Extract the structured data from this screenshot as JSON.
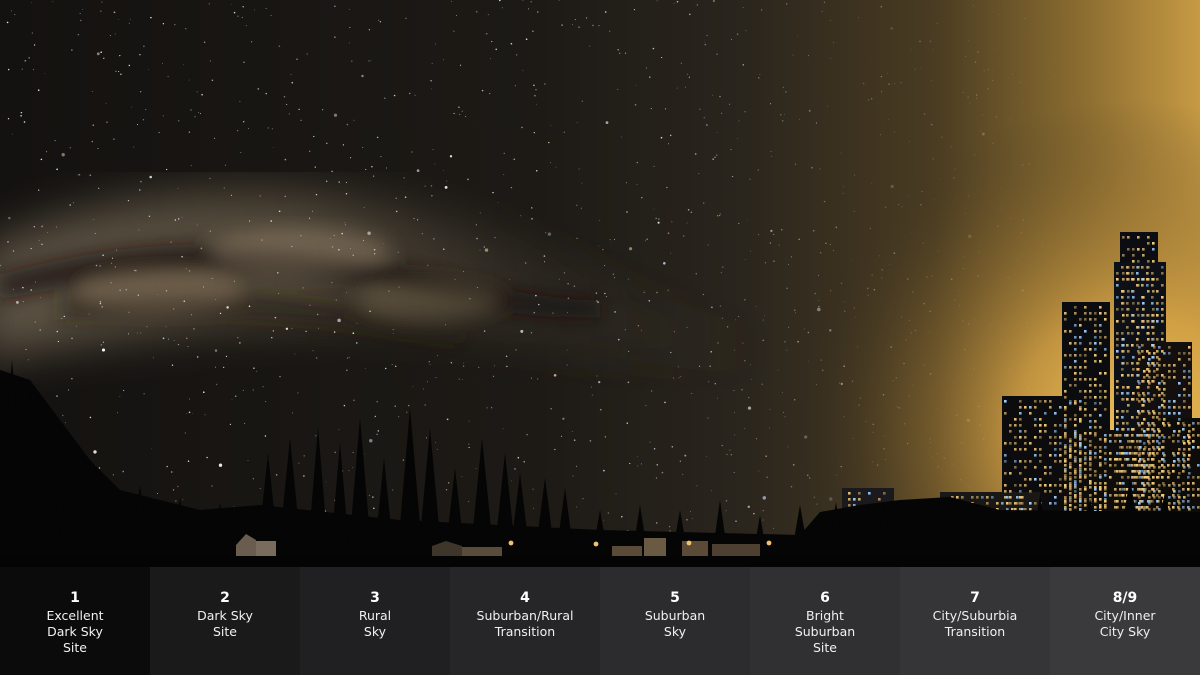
{
  "colors": {
    "sky_dark": "#151210",
    "sky_mid": "#2a241c",
    "city_glow": "#e6b24a",
    "silhouette": "#050505",
    "window_light": "#f0c878"
  },
  "scale": [
    {
      "number": "1",
      "lines": [
        "Excellent",
        "Dark Sky",
        "Site"
      ],
      "bg": "#0b0b0b"
    },
    {
      "number": "2",
      "lines": [
        "Dark Sky",
        "Site"
      ],
      "bg": "#1a1a1b"
    },
    {
      "number": "3",
      "lines": [
        "Rural",
        "Sky"
      ],
      "bg": "#202022"
    },
    {
      "number": "4",
      "lines": [
        "Suburban/Rural",
        "Transition"
      ],
      "bg": "#262628"
    },
    {
      "number": "5",
      "lines": [
        "Suburban",
        "Sky"
      ],
      "bg": "#2c2c2e"
    },
    {
      "number": "6",
      "lines": [
        "Bright",
        "Suburban",
        "Site"
      ],
      "bg": "#303033"
    },
    {
      "number": "7",
      "lines": [
        "City/Suburbia",
        "Transition"
      ],
      "bg": "#353538"
    },
    {
      "number": "8/9",
      "lines": [
        "City/Inner",
        "City Sky"
      ],
      "bg": "#3a3a3d"
    }
  ]
}
